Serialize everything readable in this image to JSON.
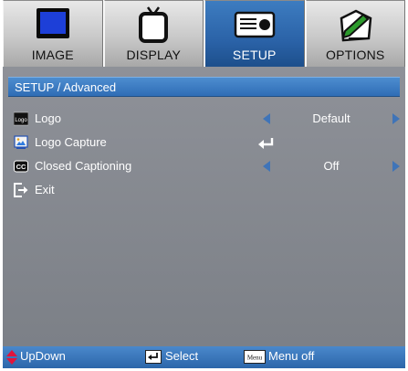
{
  "tabs": [
    {
      "label": "IMAGE",
      "icon": "monitor-icon",
      "active": false
    },
    {
      "label": "DISPLAY",
      "icon": "tv-icon",
      "active": false
    },
    {
      "label": "SETUP",
      "icon": "projector-icon",
      "active": true
    },
    {
      "label": "OPTIONS",
      "icon": "settings-pencil-icon",
      "active": false
    }
  ],
  "section_title": "SETUP / Advanced",
  "menu": {
    "logo": {
      "label": "Logo",
      "value": "Default",
      "icon": "logo-icon",
      "icon_text": "Logo"
    },
    "logo_capture": {
      "label": "Logo Capture",
      "icon": "image-capture-icon"
    },
    "closed_captioning": {
      "label": "Closed Captioning",
      "value": "Off",
      "icon": "cc-icon",
      "icon_text": "CC"
    },
    "exit": {
      "label": "Exit",
      "icon": "exit-icon"
    }
  },
  "footer": {
    "updown": "UpDown",
    "select": "Select",
    "menu_off": "Menu off",
    "menu_key_text": "Menu"
  },
  "colors": {
    "accent_blue": "#2f6db5",
    "panel_gray": "#858990",
    "arrow_blue": "#3f74b8",
    "updown_red": "#e0143c"
  }
}
